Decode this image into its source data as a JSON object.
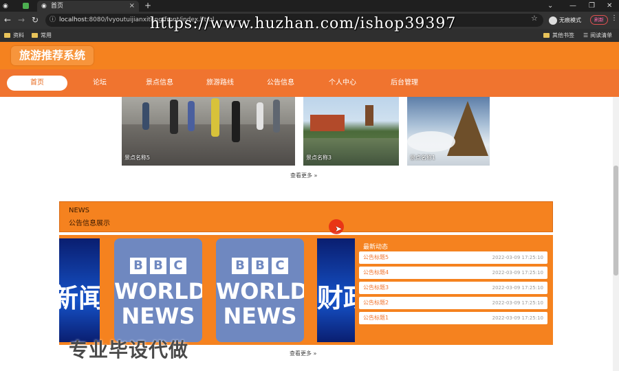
{
  "browser": {
    "tabs": [
      {
        "label": ""
      },
      {
        "label": ""
      },
      {
        "label": "首页"
      }
    ],
    "url_host": "localhost",
    "url_path": ":8080/lvyoutuijianxitong/front/index.html",
    "profile_label": "无痕模式",
    "refresh_label": "刷新",
    "bookmarks": [
      "资料",
      "常用"
    ],
    "bookmarks_right": [
      "其他书签",
      "阅读清单"
    ]
  },
  "site": {
    "logo": "旅游推荐系统",
    "nav": [
      "首页",
      "论坛",
      "景点信息",
      "旅游路线",
      "公告信息",
      "个人中心",
      "后台管理"
    ],
    "active_nav": 0
  },
  "attractions": {
    "items": [
      {
        "caption": "景点名称5"
      },
      {
        "caption": "景点名称3"
      },
      {
        "caption": "景点名称1"
      }
    ],
    "more": "查看更多 »"
  },
  "notice": {
    "heading_en": "NEWS",
    "heading_cn": "公告信息展示",
    "latest_label": "最新动态",
    "slides": [
      {
        "kind": "blue",
        "text": "新闻"
      },
      {
        "kind": "bbc",
        "lines": [
          "BBC",
          "WORLD",
          "NEWS"
        ]
      },
      {
        "kind": "bbc",
        "lines": [
          "BBC",
          "WORLD",
          "NEWS"
        ]
      },
      {
        "kind": "blue",
        "text": "财政"
      }
    ],
    "items": [
      {
        "title": "公告标题5",
        "date": "2022-03-09 17:25:10"
      },
      {
        "title": "公告标题4",
        "date": "2022-03-09 17:25:10"
      },
      {
        "title": "公告标题3",
        "date": "2022-03-09 17:25:10"
      },
      {
        "title": "公告标题2",
        "date": "2022-03-09 17:25:10"
      },
      {
        "title": "公告标题1",
        "date": "2022-03-09 17:25:10"
      }
    ],
    "more": "查看更多 »"
  },
  "overlay": {
    "watermark_url": "https://www.huzhan.com/ishop39397",
    "watermark_cn": "专业毕设代做"
  },
  "colors": {
    "brand": "#f5821f",
    "nav": "#f0742f"
  }
}
